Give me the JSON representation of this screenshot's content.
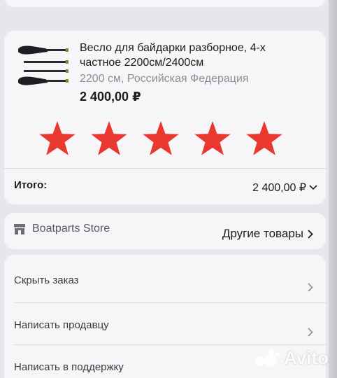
{
  "product": {
    "title": "Весло для байдарки разборное, 4-х частное 2200см/2400см",
    "subtitle": "2200 см, Российская Федерация",
    "price": "2 400,00 ₽",
    "thumbnail_icon": "paddle-image",
    "rating_stars_total": 5,
    "rating_stars_selected": 5,
    "star_color": "#e8382f"
  },
  "total": {
    "label": "Итого:",
    "value": "2 400,00 ₽"
  },
  "store": {
    "icon": "store-icon",
    "name": "Boatparts Store",
    "other_goods": "Другие товары"
  },
  "actions": [
    {
      "label": "Скрыть заказ"
    },
    {
      "label": "Написать продавцу"
    },
    {
      "label": "Написать в поддержку"
    }
  ],
  "watermark": {
    "text": "Avito"
  }
}
